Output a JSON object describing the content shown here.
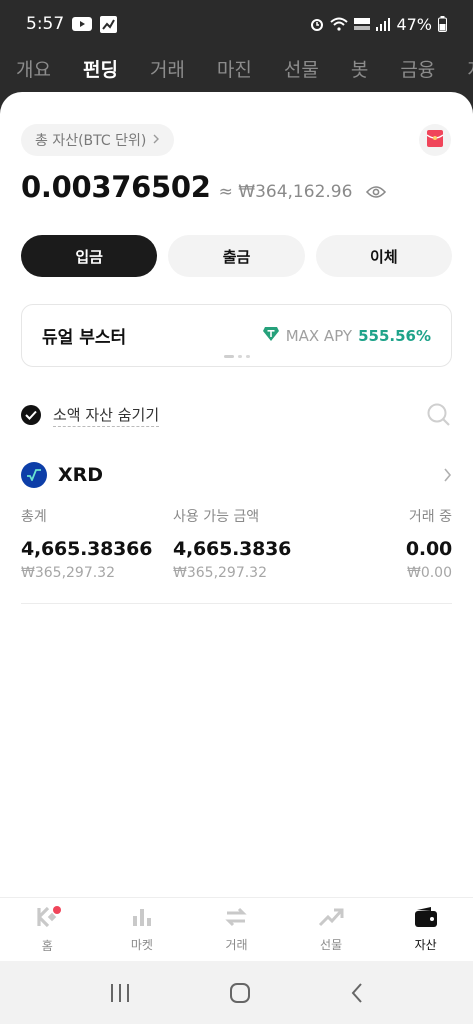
{
  "status_bar": {
    "time": "5:57",
    "battery": "47%"
  },
  "top_tabs": [
    {
      "label": "개요"
    },
    {
      "label": "펀딩"
    },
    {
      "label": "거래"
    },
    {
      "label": "마진"
    },
    {
      "label": "선물"
    },
    {
      "label": "봇"
    },
    {
      "label": "금융"
    },
    {
      "label": "지"
    }
  ],
  "summary": {
    "total_label": "총 자산(BTC 단위)",
    "balance_btc": "0.00376502",
    "balance_fiat": "≈ ₩364,162.96"
  },
  "actions": {
    "deposit": "입금",
    "withdraw": "출금",
    "transfer": "이체"
  },
  "booster": {
    "title": "듀얼 부스터",
    "apy_label": "MAX APY",
    "apy_value": "555.56%"
  },
  "filter": {
    "hide_small_label": "소액 자산 숨기기"
  },
  "asset": {
    "symbol": "XRD",
    "total_label": "총계",
    "total_value": "4,665.38366",
    "total_fiat": "₩365,297.32",
    "available_label": "사용 가능 금액",
    "available_value": "4,665.3836",
    "available_fiat": "₩365,297.32",
    "trading_label": "거래 중",
    "trading_value": "0.00",
    "trading_fiat": "₩0.00"
  },
  "bottom_nav": [
    {
      "label": "홈"
    },
    {
      "label": "마켓"
    },
    {
      "label": "거래"
    },
    {
      "label": "선물"
    },
    {
      "label": "자산"
    }
  ],
  "colors": {
    "accent_green": "#1fa38a",
    "dark": "#1b1b1b",
    "badge_red": "#f0455a"
  }
}
